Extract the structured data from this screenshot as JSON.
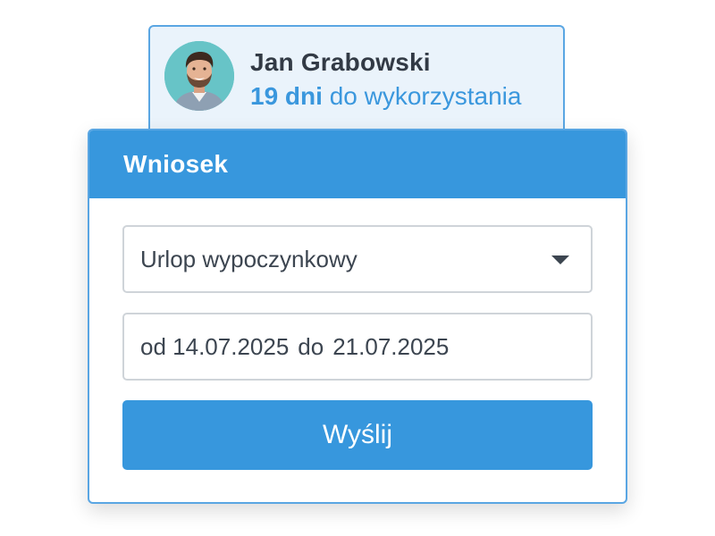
{
  "user": {
    "name": "Jan Grabowski",
    "days_count": "19 dni",
    "days_text": "do wykorzystania",
    "avatar_icon": "person-photo"
  },
  "form": {
    "title": "Wniosek",
    "leave_type": "Urlop wypoczynkowy",
    "dates": {
      "from_label": "od",
      "from": "14.07.2025",
      "to_label": "do",
      "to": "21.07.2025"
    },
    "submit_label": "Wyślij"
  },
  "colors": {
    "accent": "#3797dd",
    "accent_border": "#5aa6e3",
    "user_card_bg": "#eaf3fb",
    "text_dark": "#323a45"
  }
}
